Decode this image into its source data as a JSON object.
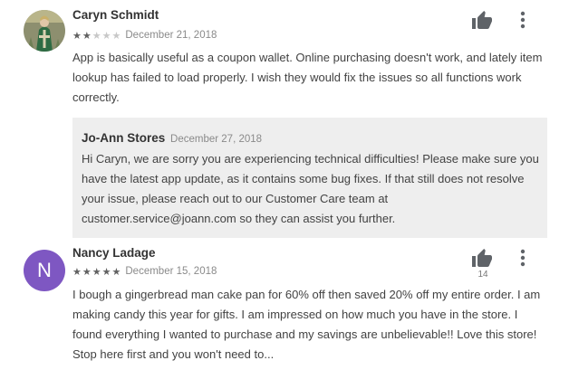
{
  "reviews": [
    {
      "author": "Caryn Schmidt",
      "avatar": {
        "type": "image",
        "icon": "profile-photo"
      },
      "rating": 2,
      "max_rating": 5,
      "date": "December 21, 2018",
      "text": "App is basically useful as a coupon wallet. Online purchasing doesn't work, and lately item lookup has failed to load properly. I wish they would fix the issues so all functions work correctly.",
      "helpful_icon": "thumbs-up-icon",
      "helpful_count": "",
      "more_icon": "more-vert-icon",
      "reply": {
        "developer": "Jo-Ann Stores",
        "date": "December 27, 2018",
        "text": "Hi Caryn, we are sorry you are experiencing technical difficulties! Please make sure you have the latest app update, as it contains some bug fixes. If that still does not resolve your issue, please reach out to our Customer Care team at customer.service@joann.com so they can assist you further."
      }
    },
    {
      "author": "Nancy Ladage",
      "avatar": {
        "type": "initial",
        "initial": "N",
        "color": "#7e57c2"
      },
      "rating": 5,
      "max_rating": 5,
      "date": "December 15, 2018",
      "text": "I bough a gingerbread man cake pan for 60% off then saved 20% off my entire order. I am making candy this year for gifts. I am impressed on how much you have in the store. I found everything I wanted to purchase and my savings are unbelievable!! Love this store! Stop here first and you won't need to...",
      "helpful_icon": "thumbs-up-icon",
      "helpful_count": "14",
      "more_icon": "more-vert-icon"
    }
  ],
  "colors": {
    "text": "#424242",
    "stars_filled": "#616161",
    "stars_empty": "#c8c8c8",
    "reply_background": "#eeeeee",
    "avatar_purple": "#7e57c2"
  }
}
